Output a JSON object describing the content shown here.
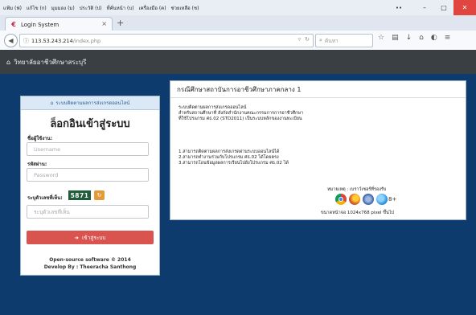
{
  "menubar": {
    "items": [
      "แฟ้ม (ฟ)",
      "แก้ไข (ก)",
      "มุมมอง (ม)",
      "ประวัติ (ป)",
      "ที่คั่นหน้า (บ)",
      "เครื่องมือ (ค)",
      "ช่วยเหลือ (ช)"
    ]
  },
  "window": {
    "minimize": "–",
    "restore": "□",
    "close": "✕",
    "more": "••"
  },
  "tab": {
    "title": "Login System",
    "close": "×",
    "new_tab": "+"
  },
  "address": {
    "host": "113.53.243.214",
    "path": "/index.php",
    "search_placeholder": "ค้นหา"
  },
  "nav": {
    "brand": "วิทยาลัยอาชีวศึกษาสระบุรี"
  },
  "login": {
    "subtitle": "ระบบติดตามผลการส่งเกรดออนไลน์",
    "title": "ล็อกอินเข้าสู่ระบบ",
    "username_label": "ชื่อผู้ใช้งาน:",
    "username_placeholder": "Username",
    "password_label": "รหัสผ่าน:",
    "password_placeholder": "Password",
    "captcha_label": "ระบุตัวเลขที่เห็น:",
    "captcha_value": "5871",
    "captcha_placeholder": "ระบุตัวเลขที่เห็น",
    "button_label": "เข้าสู่ระบบ",
    "footer_line1": "Open-source software © 2014",
    "footer_line2": "Develop By : Theeracha Santhong"
  },
  "info": {
    "heading": "กรณีศึกษาสถาบันการอาชีวศึกษาภาคกลาง 1",
    "desc_line1": "ระบบติดตามผลการส่งเกรดออนไลน์",
    "desc_line2": "สำหรับสถานศึกษาที่ สังกัดสำนักงานคณะกรรมการการอาชีวศึกษา",
    "desc_line3": "ที่ใช้โปรแกรม ศธ.02 (STD2011) เป็นระบบหลักของงานทะเบียน",
    "list": [
      "1.สามารถติดตามผลการส่งเกรดผ่านระบบออนไลน์ได้",
      "2.สามารถทำงานร่วมกับโปรแกรม ศธ.02 ได้โดยตรง",
      "3.สามารถโอนข้อมูลผลการเรียนไปยังโปรแกรม ศธ.02 ได้"
    ],
    "recommend": "หมายเหตุ : เบราว์เซอร์ที่รองรับ",
    "resolution": "ขนาดหน้าจอ 1024x768 pixel ขึ้นไป",
    "ie_plus": "8+"
  }
}
